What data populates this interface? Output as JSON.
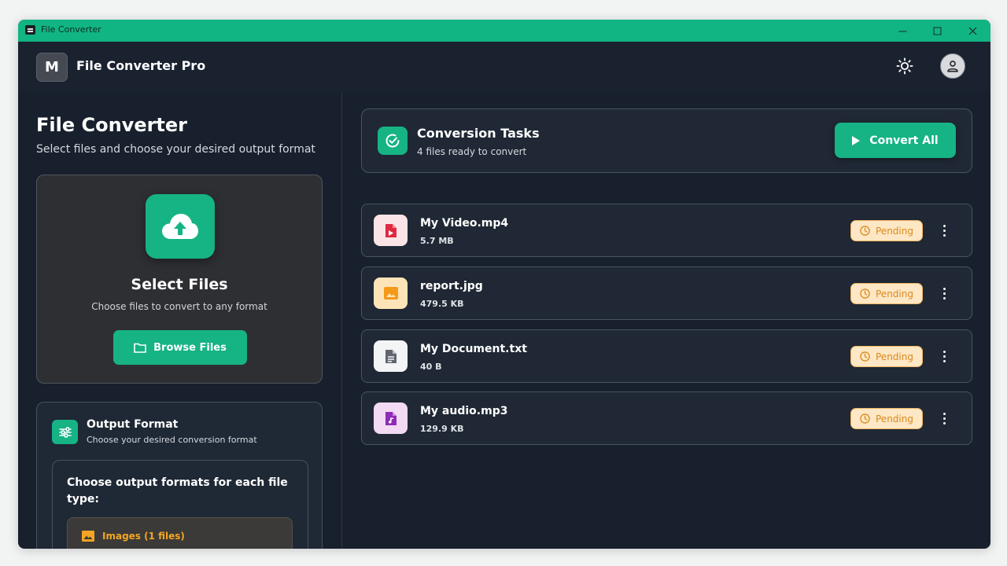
{
  "window": {
    "title": "File Converter"
  },
  "header": {
    "app_name": "File Converter Pro",
    "logo_letter": "M"
  },
  "sidebar": {
    "title": "File Converter",
    "subtitle": "Select files and choose your desired output format",
    "upload": {
      "title": "Select Files",
      "subtitle": "Choose files to convert to any format",
      "browse_label": "Browse Files"
    },
    "output_format": {
      "title": "Output Format",
      "subtitle": "Choose your desired conversion format",
      "prompt": "Choose output formats for each file type:",
      "groups": [
        {
          "label": "Images (1 files)",
          "icon": "image-icon"
        }
      ]
    }
  },
  "tasks": {
    "title": "Conversion Tasks",
    "subtitle": "4 files ready to convert",
    "convert_all_label": "Convert All",
    "files": [
      {
        "name": "My Video.mp4",
        "size": "5.7 MB",
        "status": "Pending",
        "icon": "video-file-icon"
      },
      {
        "name": "report.jpg",
        "size": "479.5 KB",
        "status": "Pending",
        "icon": "image-file-icon"
      },
      {
        "name": "My Document.txt",
        "size": "40 B",
        "status": "Pending",
        "icon": "text-file-icon"
      },
      {
        "name": "My audio.mp3",
        "size": "129.9 KB",
        "status": "Pending",
        "icon": "audio-file-icon"
      }
    ]
  },
  "colors": {
    "accent": "#16b384",
    "titlebar": "#11b584",
    "background": "#17202c",
    "pending_bg": "#fde7c4",
    "pending_text": "#d98a1f"
  }
}
